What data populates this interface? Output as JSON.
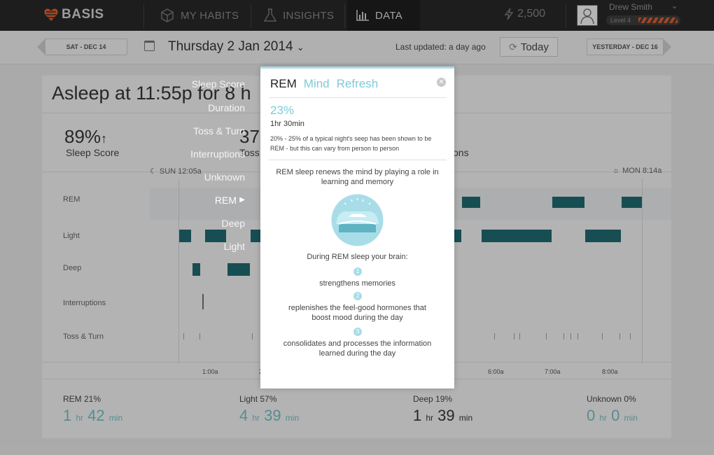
{
  "topnav": {
    "brand": "BASIS",
    "items": [
      {
        "label": "MY HABITS",
        "icon": "cube-icon"
      },
      {
        "label": "INSIGHTS",
        "icon": "flask-icon"
      },
      {
        "label": "DATA",
        "icon": "bar-chart-icon",
        "active": true
      }
    ],
    "points": "2,500",
    "user": {
      "name": "Drew Smith",
      "level": "Level 4"
    }
  },
  "datebar": {
    "prev": "SAT - DEC 14",
    "title": "Thursday 2 Jan 2014",
    "last_updated": "Last updated: a day ago",
    "today": "Today",
    "next": "YESTERDAY - DEC 16"
  },
  "summary_header": {
    "asleep": "Asleep at 11:55p  for 8 h",
    "score_value": "89%",
    "score_label": "Sleep Score",
    "hidden_value": "37",
    "toss_label": "Toss",
    "interruptions_label": "tions"
  },
  "timeline": {
    "start": "SUN 12:05a",
    "end": "MON 8:14a",
    "rows": [
      "REM",
      "Light",
      "Deep",
      "Interruptions",
      "Toss & Turn"
    ],
    "axis": [
      "1:00a",
      "2",
      "6:00a",
      "7:00a",
      "8:00a"
    ]
  },
  "stats": [
    {
      "label": "REM 21%",
      "h": "1",
      "m": "42"
    },
    {
      "label": "Light 57%",
      "h": "4",
      "m": "39"
    },
    {
      "label": "Deep 19%",
      "h": "1",
      "m": "39"
    },
    {
      "label": "Unknown 0%",
      "h": "0",
      "m": "0"
    }
  ],
  "units": {
    "hr": "hr",
    "min": "min"
  },
  "overlay_menu": [
    "Sleep Score",
    "Duration",
    "Toss & Turn",
    "Interruptions",
    "Unknown",
    "REM",
    "Deep",
    "Light"
  ],
  "modal": {
    "tabs": [
      "REM",
      "Mind",
      "Refresh"
    ],
    "percent": "23%",
    "duration": "1hr 30min",
    "description": "20% - 25% of a typical night's seep has been shown to be REM - but this can vary from person to person",
    "renew": "REM sleep renews the mind by playing a role in learning and memory",
    "during": "During REM sleep your brain:",
    "items": [
      {
        "n": "1",
        "text": "strengthens memories"
      },
      {
        "n": "2",
        "text": "replenishes the feel-good hormones that boost mood during the day"
      },
      {
        "n": "3",
        "text": "consolidates and processes the information learned during the day"
      }
    ]
  },
  "colors": {
    "accent": "#7ecad6",
    "sleep_bar": "#0b5c63",
    "brand": "#d8501e"
  }
}
